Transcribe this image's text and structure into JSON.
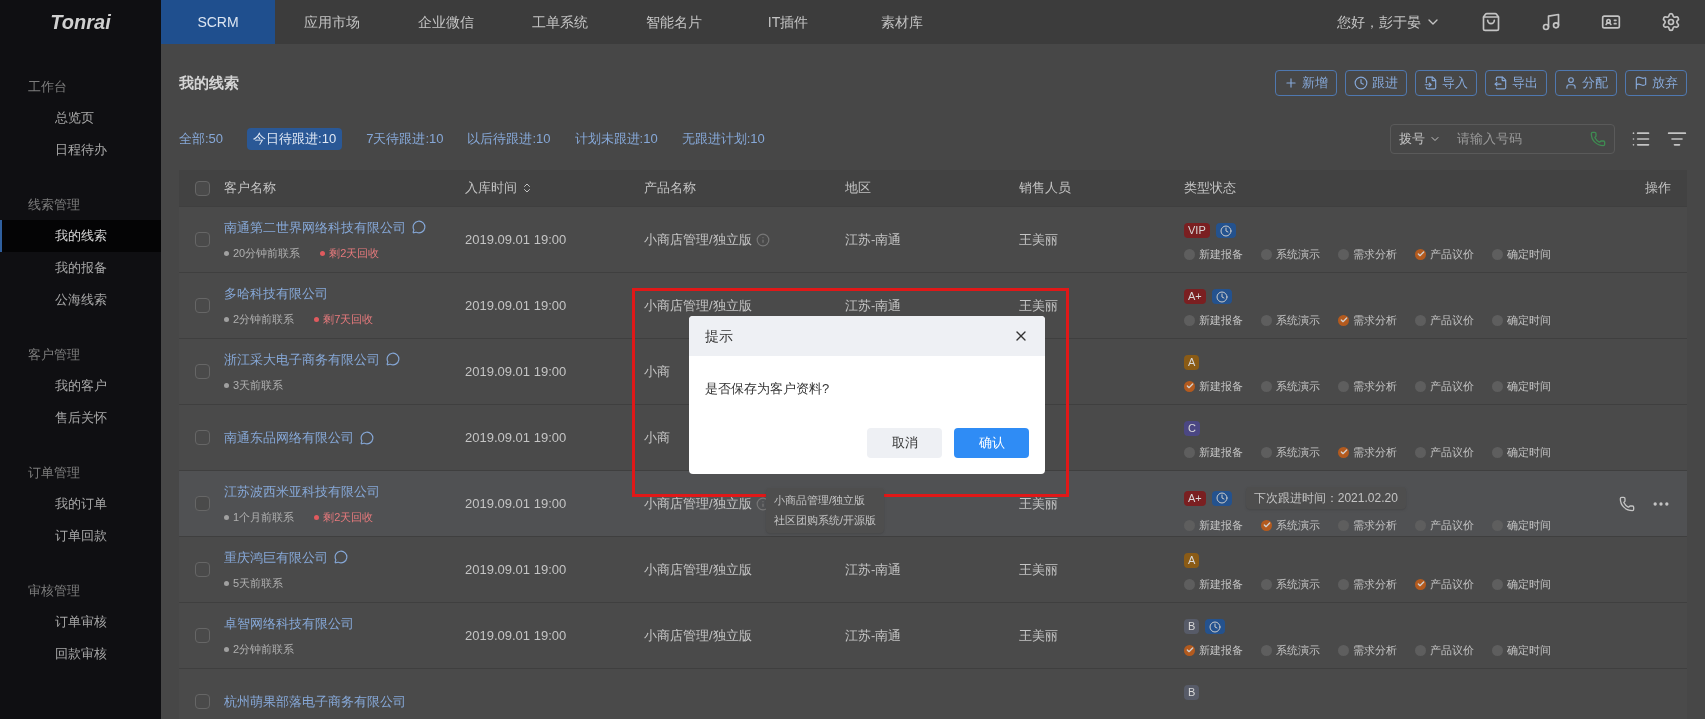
{
  "logo": "Tonrai",
  "nav_tabs": [
    {
      "label": "SCRM",
      "selected": true
    },
    {
      "label": "应用市场",
      "selected": false
    },
    {
      "label": "企业微信",
      "selected": false
    },
    {
      "label": "工单系统",
      "selected": false
    },
    {
      "label": "智能名片",
      "selected": false
    },
    {
      "label": "IT插件",
      "selected": false
    },
    {
      "label": "素材库",
      "selected": false
    }
  ],
  "greeting": "您好，彭于晏",
  "sidebar": [
    {
      "title": "工作台",
      "items": [
        {
          "label": "总览页",
          "selected": false
        },
        {
          "label": "日程待办",
          "selected": false
        }
      ]
    },
    {
      "title": "线索管理",
      "items": [
        {
          "label": "我的线索",
          "selected": true
        },
        {
          "label": "我的报备",
          "selected": false
        },
        {
          "label": "公海线索",
          "selected": false
        }
      ]
    },
    {
      "title": "客户管理",
      "items": [
        {
          "label": "我的客户",
          "selected": false
        },
        {
          "label": "售后关怀",
          "selected": false
        }
      ]
    },
    {
      "title": "订单管理",
      "items": [
        {
          "label": "我的订单",
          "selected": false
        },
        {
          "label": "订单回款",
          "selected": false
        }
      ]
    },
    {
      "title": "审核管理",
      "items": [
        {
          "label": "订单审核",
          "selected": false
        },
        {
          "label": "回款审核",
          "selected": false
        }
      ]
    }
  ],
  "page_title": "我的线索",
  "actions": [
    {
      "kind": "add",
      "label": "新增"
    },
    {
      "kind": "follow",
      "label": "跟进"
    },
    {
      "kind": "import",
      "label": "导入"
    },
    {
      "kind": "export",
      "label": "导出"
    },
    {
      "kind": "assign",
      "label": "分配"
    },
    {
      "kind": "abandon",
      "label": "放弃"
    }
  ],
  "filters": [
    {
      "label": "全部:50",
      "selected": false
    },
    {
      "label": "今日待跟进:10",
      "selected": true
    },
    {
      "label": "7天待跟进:10",
      "selected": false
    },
    {
      "label": "以后待跟进:10",
      "selected": false
    },
    {
      "label": "计划未跟进:10",
      "selected": false
    },
    {
      "label": "无跟进计划:10",
      "selected": false
    }
  ],
  "dial_select": "拨号",
  "phone_field": {
    "placeholder": "请输入号码"
  },
  "select_all": {
    "checked": false
  },
  "columns": [
    "客户名称",
    "入库时间",
    "产品名称",
    "地区",
    "销售人员",
    "类型状态",
    "操作"
  ],
  "rows": [
    {
      "checked": false,
      "name": "南通第二世界网络科技有限公司",
      "chat": true,
      "contact": "20分钟前联系",
      "recycle": "剩2天回收",
      "time": "2019.09.01 19:00",
      "product": "小商店管理/独立版",
      "info": true,
      "region": "江苏-南通",
      "sales": "王美丽",
      "tag": {
        "label": "VIP",
        "color": "#7a1f21"
      },
      "clock": true,
      "highlighted": false,
      "stages": [
        {
          "label": "新建报备",
          "checked": false
        },
        {
          "label": "系统演示",
          "checked": false
        },
        {
          "label": "需求分析",
          "checked": false
        },
        {
          "label": "产品议价",
          "checked": true
        },
        {
          "label": "确定时间",
          "checked": false
        }
      ]
    },
    {
      "checked": false,
      "name": "多哈科技有限公司",
      "chat": false,
      "contact": "2分钟前联系",
      "recycle": "剩7天回收",
      "time": "2019.09.01 19:00",
      "product": "小商店管理/独立版",
      "info": false,
      "region": "江苏-南通",
      "sales": "王美丽",
      "tag": {
        "label": "A+",
        "color": "#7a1f21"
      },
      "clock": true,
      "highlighted": false,
      "stages": [
        {
          "label": "新建报备",
          "checked": false
        },
        {
          "label": "系统演示",
          "checked": false
        },
        {
          "label": "需求分析",
          "checked": true
        },
        {
          "label": "产品议价",
          "checked": false
        },
        {
          "label": "确定时间",
          "checked": false
        }
      ]
    },
    {
      "checked": false,
      "name": "浙江采大电子商务有限公司",
      "chat": true,
      "contact": "3天前联系",
      "time": "2019.09.01 19:00",
      "product": "小商",
      "info": false,
      "tag": {
        "label": "A",
        "color": "#8a5b16"
      },
      "clock": false,
      "highlighted": false,
      "stages": [
        {
          "label": "新建报备",
          "checked": true
        },
        {
          "label": "系统演示",
          "checked": false
        },
        {
          "label": "需求分析",
          "checked": false
        },
        {
          "label": "产品议价",
          "checked": false
        },
        {
          "label": "确定时间",
          "checked": false
        }
      ]
    },
    {
      "checked": false,
      "name": "南通东品网络有限公司",
      "chat": true,
      "time": "2019.09.01 19:00",
      "product": "小商",
      "info": false,
      "tag": {
        "label": "C",
        "color": "#4b4783"
      },
      "clock": false,
      "highlighted": false,
      "stages": [
        {
          "label": "新建报备",
          "checked": false
        },
        {
          "label": "系统演示",
          "checked": false
        },
        {
          "label": "需求分析",
          "checked": true
        },
        {
          "label": "产品议价",
          "checked": false
        },
        {
          "label": "确定时间",
          "checked": false
        }
      ]
    },
    {
      "checked": false,
      "name": "江苏波西米亚科技有限公司",
      "chat": false,
      "contact": "1个月前联系",
      "recycle": "剩2天回收",
      "time": "2019.09.01 19:00",
      "product": "小商店管理/独立版",
      "info": true,
      "product_tip": [
        "小商品管理/独立版",
        "社区团购系统/开源版"
      ],
      "sales": "王美丽",
      "tag": {
        "label": "A+",
        "color": "#7a1f21"
      },
      "clock": true,
      "next_follow": "下次跟进时间：2021.02.20",
      "highlighted": true,
      "stages": [
        {
          "label": "新建报备",
          "checked": false
        },
        {
          "label": "系统演示",
          "checked": true
        },
        {
          "label": "需求分析",
          "checked": false
        },
        {
          "label": "产品议价",
          "checked": false
        },
        {
          "label": "确定时间",
          "checked": false
        }
      ]
    },
    {
      "checked": false,
      "name": "重庆鸿巨有限公司",
      "chat": true,
      "contact": "5天前联系",
      "time": "2019.09.01 19:00",
      "product": "小商店管理/独立版",
      "info": false,
      "region": "江苏-南通",
      "sales": "王美丽",
      "tag": {
        "label": "A",
        "color": "#8a5b16"
      },
      "clock": false,
      "highlighted": false,
      "stages": [
        {
          "label": "新建报备",
          "checked": false
        },
        {
          "label": "系统演示",
          "checked": false
        },
        {
          "label": "需求分析",
          "checked": false
        },
        {
          "label": "产品议价",
          "checked": true
        },
        {
          "label": "确定时间",
          "checked": false
        }
      ]
    },
    {
      "checked": false,
      "name": "卓智网络科技有限公司",
      "chat": false,
      "contact": "2分钟前联系",
      "time": "2019.09.01 19:00",
      "product": "小商店管理/独立版",
      "info": false,
      "region": "江苏-南通",
      "sales": "王美丽",
      "tag": {
        "label": "B",
        "color": "#575b68"
      },
      "clock": true,
      "highlighted": false,
      "stages": [
        {
          "label": "新建报备",
          "checked": true
        },
        {
          "label": "系统演示",
          "checked": false
        },
        {
          "label": "需求分析",
          "checked": false
        },
        {
          "label": "产品议价",
          "checked": false
        },
        {
          "label": "确定时间",
          "checked": false
        }
      ]
    },
    {
      "checked": false,
      "name": "杭州萌果部落电子商务有限公司",
      "chat": false,
      "info": false,
      "tag": {
        "label": "B",
        "color": "#575b68"
      },
      "clock": false,
      "highlighted": false
    }
  ],
  "dialog": {
    "title": "提示",
    "message": "是否保存为客户资料?",
    "buttons": [
      {
        "kind": "secondary",
        "label": "取消"
      },
      {
        "kind": "primary",
        "label": "确认"
      }
    ]
  }
}
